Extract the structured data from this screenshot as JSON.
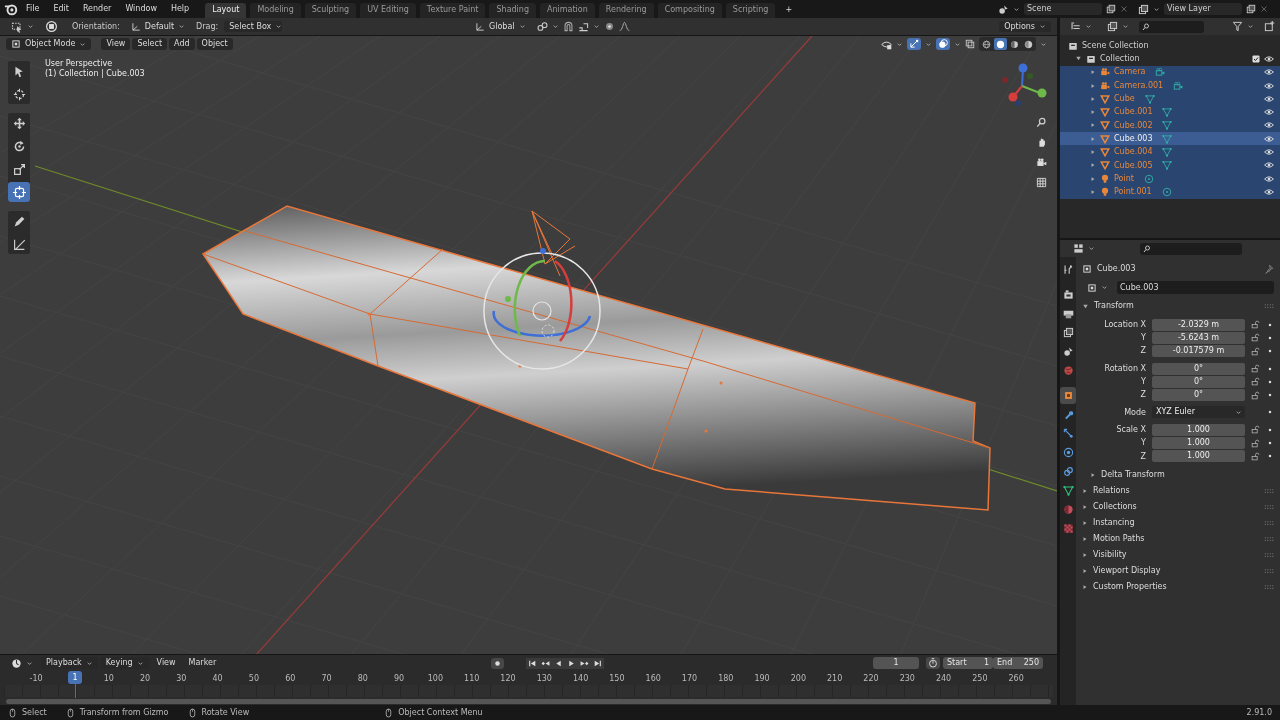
{
  "menu": [
    "File",
    "Edit",
    "Render",
    "Window",
    "Help"
  ],
  "workspaces": [
    {
      "label": "Layout",
      "selected": true
    },
    {
      "label": "Modeling",
      "selected": false
    },
    {
      "label": "Sculpting",
      "selected": false
    },
    {
      "label": "UV Editing",
      "selected": false
    },
    {
      "label": "Texture Paint",
      "selected": false
    },
    {
      "label": "Shading",
      "selected": false
    },
    {
      "label": "Animation",
      "selected": false
    },
    {
      "label": "Rendering",
      "selected": false
    },
    {
      "label": "Compositing",
      "selected": false
    },
    {
      "label": "Scripting",
      "selected": false
    }
  ],
  "add_workspace": "+",
  "scene": "Scene",
  "view_layer": "View Layer",
  "tool_header": {
    "orientation_label": "Orientation:",
    "orientation": "Default",
    "drag_label": "Drag:",
    "drag": "Select Box",
    "transform_orientation": "Global",
    "options": "Options"
  },
  "viewport": {
    "mode": "Object Mode",
    "menus": [
      "View",
      "Select",
      "Add",
      "Object"
    ],
    "perspective": "User Perspective",
    "context": "(1) Collection | Cube.003",
    "tool_groups": [
      [
        {
          "kind": "select",
          "selected": false
        },
        {
          "kind": "cursor",
          "selected": false
        }
      ],
      [
        {
          "kind": "move",
          "selected": false
        },
        {
          "kind": "rotate",
          "selected": false
        },
        {
          "kind": "scale",
          "selected": false
        },
        {
          "kind": "transform",
          "selected": true
        }
      ],
      [
        {
          "kind": "annotate",
          "selected": false
        },
        {
          "kind": "measure",
          "selected": false
        }
      ]
    ],
    "shading": [
      {
        "kind": "wireframe",
        "selected": false
      },
      {
        "kind": "solid",
        "selected": true
      },
      {
        "kind": "material",
        "selected": false
      },
      {
        "kind": "rendered",
        "selected": false
      }
    ]
  },
  "outliner": {
    "root": "Scene Collection",
    "collections": [
      {
        "label": "Collection",
        "checked": true,
        "expanded": true,
        "children": [
          {
            "label": "Camera",
            "kind": "camera",
            "selected": true,
            "active": false
          },
          {
            "label": "Camera.001",
            "kind": "camera",
            "selected": true,
            "active": false
          },
          {
            "label": "Cube",
            "kind": "mesh",
            "selected": true,
            "active": false
          },
          {
            "label": "Cube.001",
            "kind": "mesh",
            "selected": true,
            "active": false
          },
          {
            "label": "Cube.002",
            "kind": "mesh",
            "selected": true,
            "active": false
          },
          {
            "label": "Cube.003",
            "kind": "mesh",
            "selected": true,
            "active": true
          },
          {
            "label": "Cube.004",
            "kind": "mesh",
            "selected": true,
            "active": false
          },
          {
            "label": "Cube.005",
            "kind": "mesh",
            "selected": true,
            "active": false
          },
          {
            "label": "Point",
            "kind": "light",
            "selected": true,
            "active": false
          },
          {
            "label": "Point.001",
            "kind": "light",
            "selected": true,
            "active": false
          }
        ]
      }
    ]
  },
  "properties": {
    "object": "Cube.003",
    "datablock": "Cube.003",
    "tabs": [
      {
        "kind": "tool",
        "selected": false
      },
      {
        "kind": "render",
        "selected": false
      },
      {
        "kind": "output",
        "selected": false
      },
      {
        "kind": "view_layer",
        "selected": false
      },
      {
        "kind": "scene",
        "selected": false
      },
      {
        "kind": "world",
        "selected": false
      },
      {
        "kind": "object",
        "selected": true
      },
      {
        "kind": "modifiers",
        "selected": false
      },
      {
        "kind": "particles",
        "selected": false
      },
      {
        "kind": "physics",
        "selected": false
      },
      {
        "kind": "constraints",
        "selected": false
      },
      {
        "kind": "data",
        "selected": false
      },
      {
        "kind": "material",
        "selected": false
      },
      {
        "kind": "texture",
        "selected": false
      }
    ],
    "transform": {
      "title": "Transform",
      "expanded": true,
      "groups": [
        {
          "rows": [
            {
              "label": "Location X",
              "value": "-2.0329 m",
              "kind": "number"
            },
            {
              "label": "Y",
              "value": "-5.6243 m",
              "kind": "number"
            },
            {
              "label": "Z",
              "value": "-0.017579 m",
              "kind": "number"
            }
          ]
        },
        {
          "rows": [
            {
              "label": "Rotation X",
              "value": "0°",
              "kind": "number"
            },
            {
              "label": "Y",
              "value": "0°",
              "kind": "number"
            },
            {
              "label": "Z",
              "value": "0°",
              "kind": "number"
            }
          ]
        },
        {
          "rows": [
            {
              "label": "Mode",
              "value": "XYZ Euler",
              "kind": "select"
            }
          ]
        },
        {
          "rows": [
            {
              "label": "Scale X",
              "value": "1.000",
              "kind": "number"
            },
            {
              "label": "Y",
              "value": "1.000",
              "kind": "number"
            },
            {
              "label": "Z",
              "value": "1.000",
              "kind": "number"
            }
          ]
        }
      ],
      "subpanels": [
        {
          "label": "Delta Transform",
          "expanded": false
        }
      ]
    },
    "panels": [
      {
        "label": "Relations",
        "expanded": false
      },
      {
        "label": "Collections",
        "expanded": false
      },
      {
        "label": "Instancing",
        "expanded": false
      },
      {
        "label": "Motion Paths",
        "expanded": false
      },
      {
        "label": "Visibility",
        "expanded": false
      },
      {
        "label": "Viewport Display",
        "expanded": false
      },
      {
        "label": "Custom Properties",
        "expanded": false
      }
    ]
  },
  "timeline": {
    "menus": [
      {
        "label": "Playback",
        "dropdown": true
      },
      {
        "label": "Keying",
        "dropdown": true
      },
      {
        "label": "View",
        "dropdown": false
      },
      {
        "label": "Marker",
        "dropdown": false
      }
    ],
    "current_frame": "1",
    "start_label": "Start",
    "start": "1",
    "end_label": "End",
    "end": "250",
    "playhead": "1",
    "ruler": [
      "-10",
      "10",
      "20",
      "30",
      "40",
      "50",
      "60",
      "70",
      "80",
      "90",
      "100",
      "110",
      "120",
      "130",
      "140",
      "150",
      "160",
      "170",
      "180",
      "190",
      "200",
      "210",
      "220",
      "230",
      "240",
      "250",
      "260"
    ]
  },
  "status_bar": {
    "hints": [
      {
        "label": "Select"
      },
      {
        "label": "Transform from Gizmo"
      },
      {
        "label": "Rotate View"
      },
      {
        "label": "Object Context Menu"
      }
    ],
    "version": "2.91.0"
  }
}
